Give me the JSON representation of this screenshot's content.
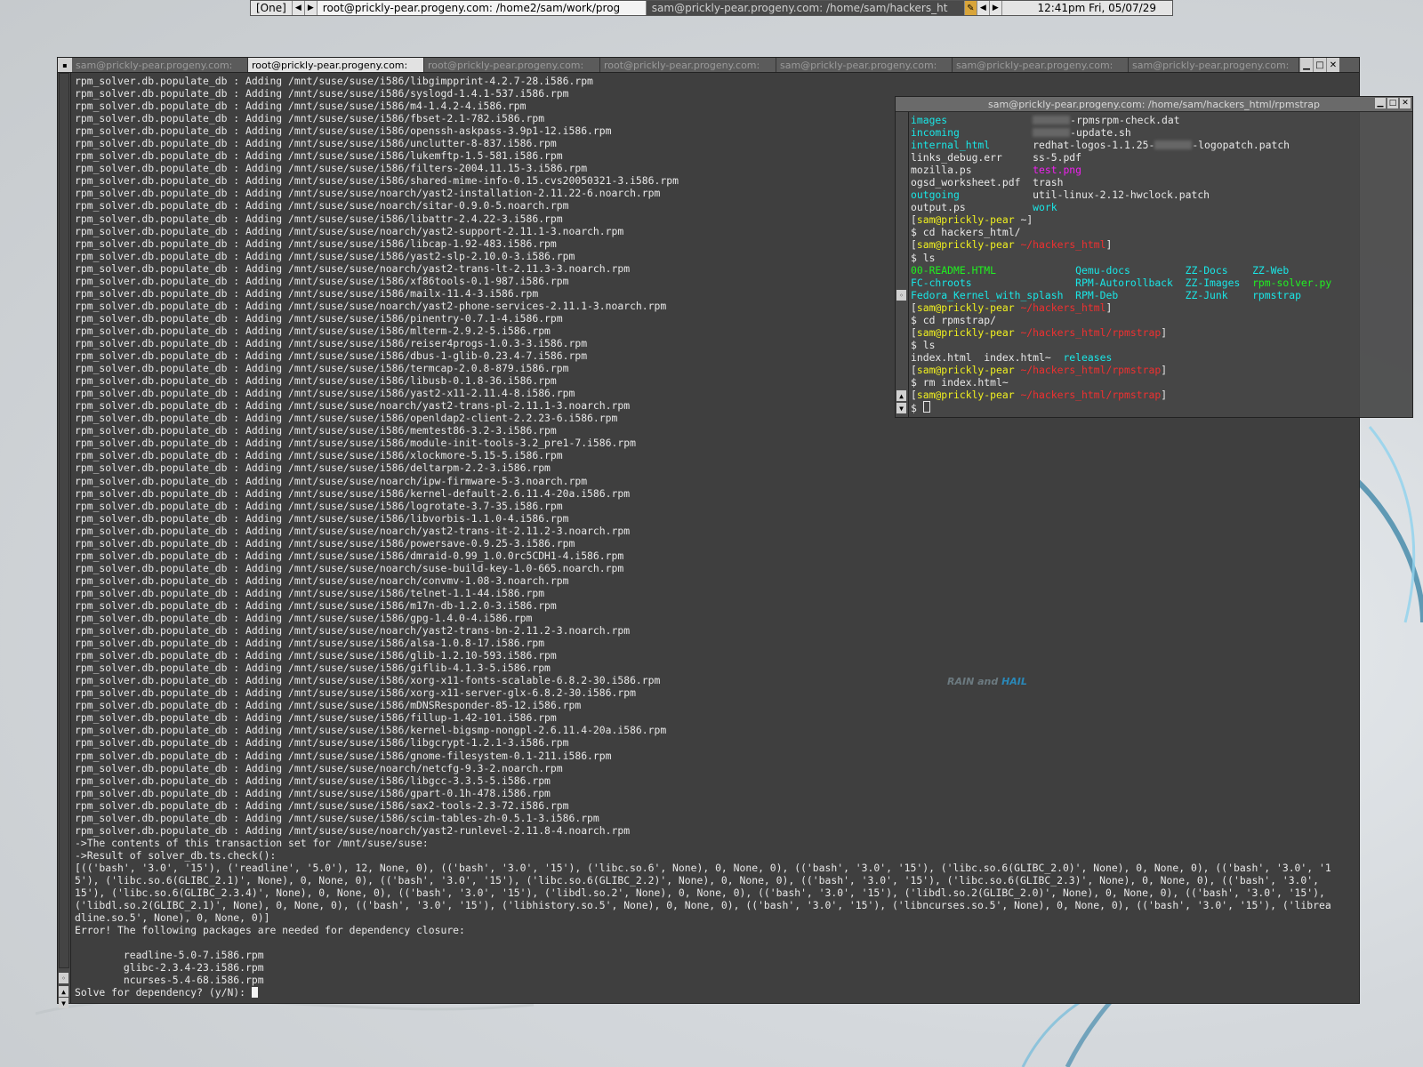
{
  "taskbar": {
    "workspace": "[One]",
    "task_active": "root@prickly-pear.progeny.com: /home2/sam/work/prog",
    "task_inactive": "sam@prickly-pear.progeny.com: /home/sam/hackers_ht",
    "clock": "12:41pm Fri, 05/07/29"
  },
  "main_window": {
    "tabs": [
      "sam@prickly-pear.progeny.com:",
      "root@prickly-pear.progeny.com:",
      "root@prickly-pear.progeny.com:",
      "root@prickly-pear.progeny.com:",
      "sam@prickly-pear.progeny.com:",
      "sam@prickly-pear.progeny.com:",
      "sam@prickly-pear.progeny.com:"
    ],
    "active_tab": 1,
    "log_prefix": "rpm_solver.db.populate_db : Adding ",
    "packages": [
      "/mnt/suse/suse/i586/libgimpprint-4.2.7-28.i586.rpm",
      "/mnt/suse/suse/i586/syslogd-1.4.1-537.i586.rpm",
      "/mnt/suse/suse/i586/m4-1.4.2-4.i586.rpm",
      "/mnt/suse/suse/i586/fbset-2.1-782.i586.rpm",
      "/mnt/suse/suse/i586/openssh-askpass-3.9p1-12.i586.rpm",
      "/mnt/suse/suse/i586/unclutter-8-837.i586.rpm",
      "/mnt/suse/suse/i586/lukemftp-1.5-581.i586.rpm",
      "/mnt/suse/suse/i586/filters-2004.11.15-3.i586.rpm",
      "/mnt/suse/suse/i586/shared-mime-info-0.15.cvs20050321-3.i586.rpm",
      "/mnt/suse/suse/noarch/yast2-installation-2.11.22-6.noarch.rpm",
      "/mnt/suse/suse/noarch/sitar-0.9.0-5.noarch.rpm",
      "/mnt/suse/suse/i586/libattr-2.4.22-3.i586.rpm",
      "/mnt/suse/suse/noarch/yast2-support-2.11.1-3.noarch.rpm",
      "/mnt/suse/suse/i586/libcap-1.92-483.i586.rpm",
      "/mnt/suse/suse/i586/yast2-slp-2.10.0-3.i586.rpm",
      "/mnt/suse/suse/noarch/yast2-trans-lt-2.11.3-3.noarch.rpm",
      "/mnt/suse/suse/i586/xf86tools-0.1-987.i586.rpm",
      "/mnt/suse/suse/i586/mailx-11.4-3.i586.rpm",
      "/mnt/suse/suse/noarch/yast2-phone-services-2.11.1-3.noarch.rpm",
      "/mnt/suse/suse/i586/pinentry-0.7.1-4.i586.rpm",
      "/mnt/suse/suse/i586/mlterm-2.9.2-5.i586.rpm",
      "/mnt/suse/suse/i586/reiser4progs-1.0.3-3.i586.rpm",
      "/mnt/suse/suse/i586/dbus-1-glib-0.23.4-7.i586.rpm",
      "/mnt/suse/suse/i586/termcap-2.0.8-879.i586.rpm",
      "/mnt/suse/suse/i586/libusb-0.1.8-36.i586.rpm",
      "/mnt/suse/suse/i586/yast2-x11-2.11.4-8.i586.rpm",
      "/mnt/suse/suse/noarch/yast2-trans-pl-2.11.1-3.noarch.rpm",
      "/mnt/suse/suse/i586/openldap2-client-2.2.23-6.i586.rpm",
      "/mnt/suse/suse/i586/memtest86-3.2-3.i586.rpm",
      "/mnt/suse/suse/i586/module-init-tools-3.2_pre1-7.i586.rpm",
      "/mnt/suse/suse/i586/xlockmore-5.15-5.i586.rpm",
      "/mnt/suse/suse/i586/deltarpm-2.2-3.i586.rpm",
      "/mnt/suse/suse/noarch/ipw-firmware-5-3.noarch.rpm",
      "/mnt/suse/suse/i586/kernel-default-2.6.11.4-20a.i586.rpm",
      "/mnt/suse/suse/i586/logrotate-3.7-35.i586.rpm",
      "/mnt/suse/suse/i586/libvorbis-1.1.0-4.i586.rpm",
      "/mnt/suse/suse/noarch/yast2-trans-it-2.11.2-3.noarch.rpm",
      "/mnt/suse/suse/i586/powersave-0.9.25-3.i586.rpm",
      "/mnt/suse/suse/i586/dmraid-0.99_1.0.0rc5CDH1-4.i586.rpm",
      "/mnt/suse/suse/noarch/suse-build-key-1.0-665.noarch.rpm",
      "/mnt/suse/suse/noarch/convmv-1.08-3.noarch.rpm",
      "/mnt/suse/suse/i586/telnet-1.1-44.i586.rpm",
      "/mnt/suse/suse/i586/m17n-db-1.2.0-3.i586.rpm",
      "/mnt/suse/suse/i586/gpg-1.4.0-4.i586.rpm",
      "/mnt/suse/suse/noarch/yast2-trans-bn-2.11.2-3.noarch.rpm",
      "/mnt/suse/suse/i586/alsa-1.0.8-17.i586.rpm",
      "/mnt/suse/suse/i586/glib-1.2.10-593.i586.rpm",
      "/mnt/suse/suse/i586/giflib-4.1.3-5.i586.rpm",
      "/mnt/suse/suse/i586/xorg-x11-fonts-scalable-6.8.2-30.i586.rpm",
      "/mnt/suse/suse/i586/xorg-x11-server-glx-6.8.2-30.i586.rpm",
      "/mnt/suse/suse/i586/mDNSResponder-85-12.i586.rpm",
      "/mnt/suse/suse/i586/fillup-1.42-101.i586.rpm",
      "/mnt/suse/suse/i586/kernel-bigsmp-nongpl-2.6.11.4-20a.i586.rpm",
      "/mnt/suse/suse/i586/libgcrypt-1.2.1-3.i586.rpm",
      "/mnt/suse/suse/i586/gnome-filesystem-0.1-211.i586.rpm",
      "/mnt/suse/suse/noarch/netcfg-9.3-2.noarch.rpm",
      "/mnt/suse/suse/i586/libgcc-3.3.5-5.i586.rpm",
      "/mnt/suse/suse/i586/gpart-0.1h-478.i586.rpm",
      "/mnt/suse/suse/i586/sax2-tools-2.3-72.i586.rpm",
      "/mnt/suse/suse/i586/scim-tables-zh-0.5.1-3.i586.rpm",
      "/mnt/suse/suse/noarch/yast2-runlevel-2.11.8-4.noarch.rpm"
    ],
    "tail_lines": [
      "->The contents of this transaction set for /mnt/suse/suse:",
      "->Result of solver_db.ts.check():",
      "[(('bash', '3.0', '15'), ('readline', '5.0'), 12, None, 0), (('bash', '3.0', '15'), ('libc.so.6', None), 0, None, 0), (('bash', '3.0', '15'), ('libc.so.6(GLIBC_2.0)', None), 0, None, 0), (('bash', '3.0', '1",
      "5'), ('libc.so.6(GLIBC_2.1)', None), 0, None, 0), (('bash', '3.0', '15'), ('libc.so.6(GLIBC_2.2)', None), 0, None, 0), (('bash', '3.0', '15'), ('libc.so.6(GLIBC_2.3)', None), 0, None, 0), (('bash', '3.0',",
      "15'), ('libc.so.6(GLIBC_2.3.4)', None), 0, None, 0), (('bash', '3.0', '15'), ('libdl.so.2', None), 0, None, 0), (('bash', '3.0', '15'), ('libdl.so.2(GLIBC_2.0)', None), 0, None, 0), (('bash', '3.0', '15'),",
      "('libdl.so.2(GLIBC_2.1)', None), 0, None, 0), (('bash', '3.0', '15'), ('libhistory.so.5', None), 0, None, 0), (('bash', '3.0', '15'), ('libncurses.so.5', None), 0, None, 0), (('bash', '3.0', '15'), ('librea",
      "dline.so.5', None), 0, None, 0)]",
      "Error! The following packages are needed for dependency closure:",
      "",
      "        readline-5.0-7.i586.rpm",
      "        glibc-2.3.4-23.i586.rpm",
      "        ncurses-5.4-68.i586.rpm"
    ],
    "prompt": "Solve for dependency? (y/N): "
  },
  "small_window": {
    "title": "sam@prickly-pear.progeny.com: /home/sam/hackers_html/rpmstrap",
    "ls_rows": [
      {
        "left": "images",
        "left_color": "cyan",
        "right": "-rpmsrpm-check.dat",
        "right_color": "white",
        "redacted": true
      },
      {
        "left": "incoming",
        "left_color": "cyan",
        "right": "-update.sh",
        "right_color": "white",
        "redacted": true
      },
      {
        "left": "internal_html",
        "left_color": "cyan",
        "right": "redhat-logos-1.1.25-",
        "right_tail": "-logopatch.patch",
        "right_color": "white",
        "redacted": true
      },
      {
        "left": "links_debug.err",
        "left_color": "white",
        "right": "ss-5.pdf",
        "right_color": "white"
      },
      {
        "left": "mozilla.ps",
        "left_color": "white",
        "right": "test.png",
        "right_color": "magenta"
      },
      {
        "left": "ogsd_worksheet.pdf",
        "left_color": "white",
        "right": "trash",
        "right_color": "white"
      },
      {
        "left": "outgoing",
        "left_color": "cyan",
        "right": "util-linux-2.12-hwclock.patch",
        "right_color": "white"
      },
      {
        "left": "output.ps",
        "left_color": "white",
        "right": "work",
        "right_color": "cyan"
      }
    ],
    "prompt_user": "sam@prickly-pear",
    "paths": {
      "home": "~",
      "hackers": "~/hackers_html",
      "rpmstrap": "~/hackers_html/rpmstrap"
    },
    "commands": {
      "cd_hackers": "$ cd hackers_html/",
      "ls": "$ ls",
      "cd_rpmstrap": "$ cd rpmstrap/",
      "rm": "$ rm index.html~",
      "final": "$ "
    },
    "hackers_ls": [
      [
        "00-README.HTML",
        "Qemu-docs",
        "ZZ-Docs",
        "ZZ-Web"
      ],
      [
        "FC-chroots",
        "RPM-Autorollback",
        "ZZ-Images",
        "rpm-solver.py"
      ],
      [
        "Fedora_Kernel_with_splash",
        "RPM-Deb",
        "ZZ-Junk",
        "rpmstrap"
      ]
    ],
    "hackers_ls_colors": [
      [
        "green",
        "cyan",
        "cyan",
        "cyan"
      ],
      [
        "cyan",
        "cyan",
        "cyan",
        "green"
      ],
      [
        "cyan",
        "cyan",
        "cyan",
        "cyan"
      ]
    ],
    "rpmstrap_ls": [
      "index.html",
      "index.html~",
      "releases"
    ]
  },
  "wallpaper": {
    "logo_rain": "RAIN and ",
    "logo_hail": "HAIL"
  }
}
